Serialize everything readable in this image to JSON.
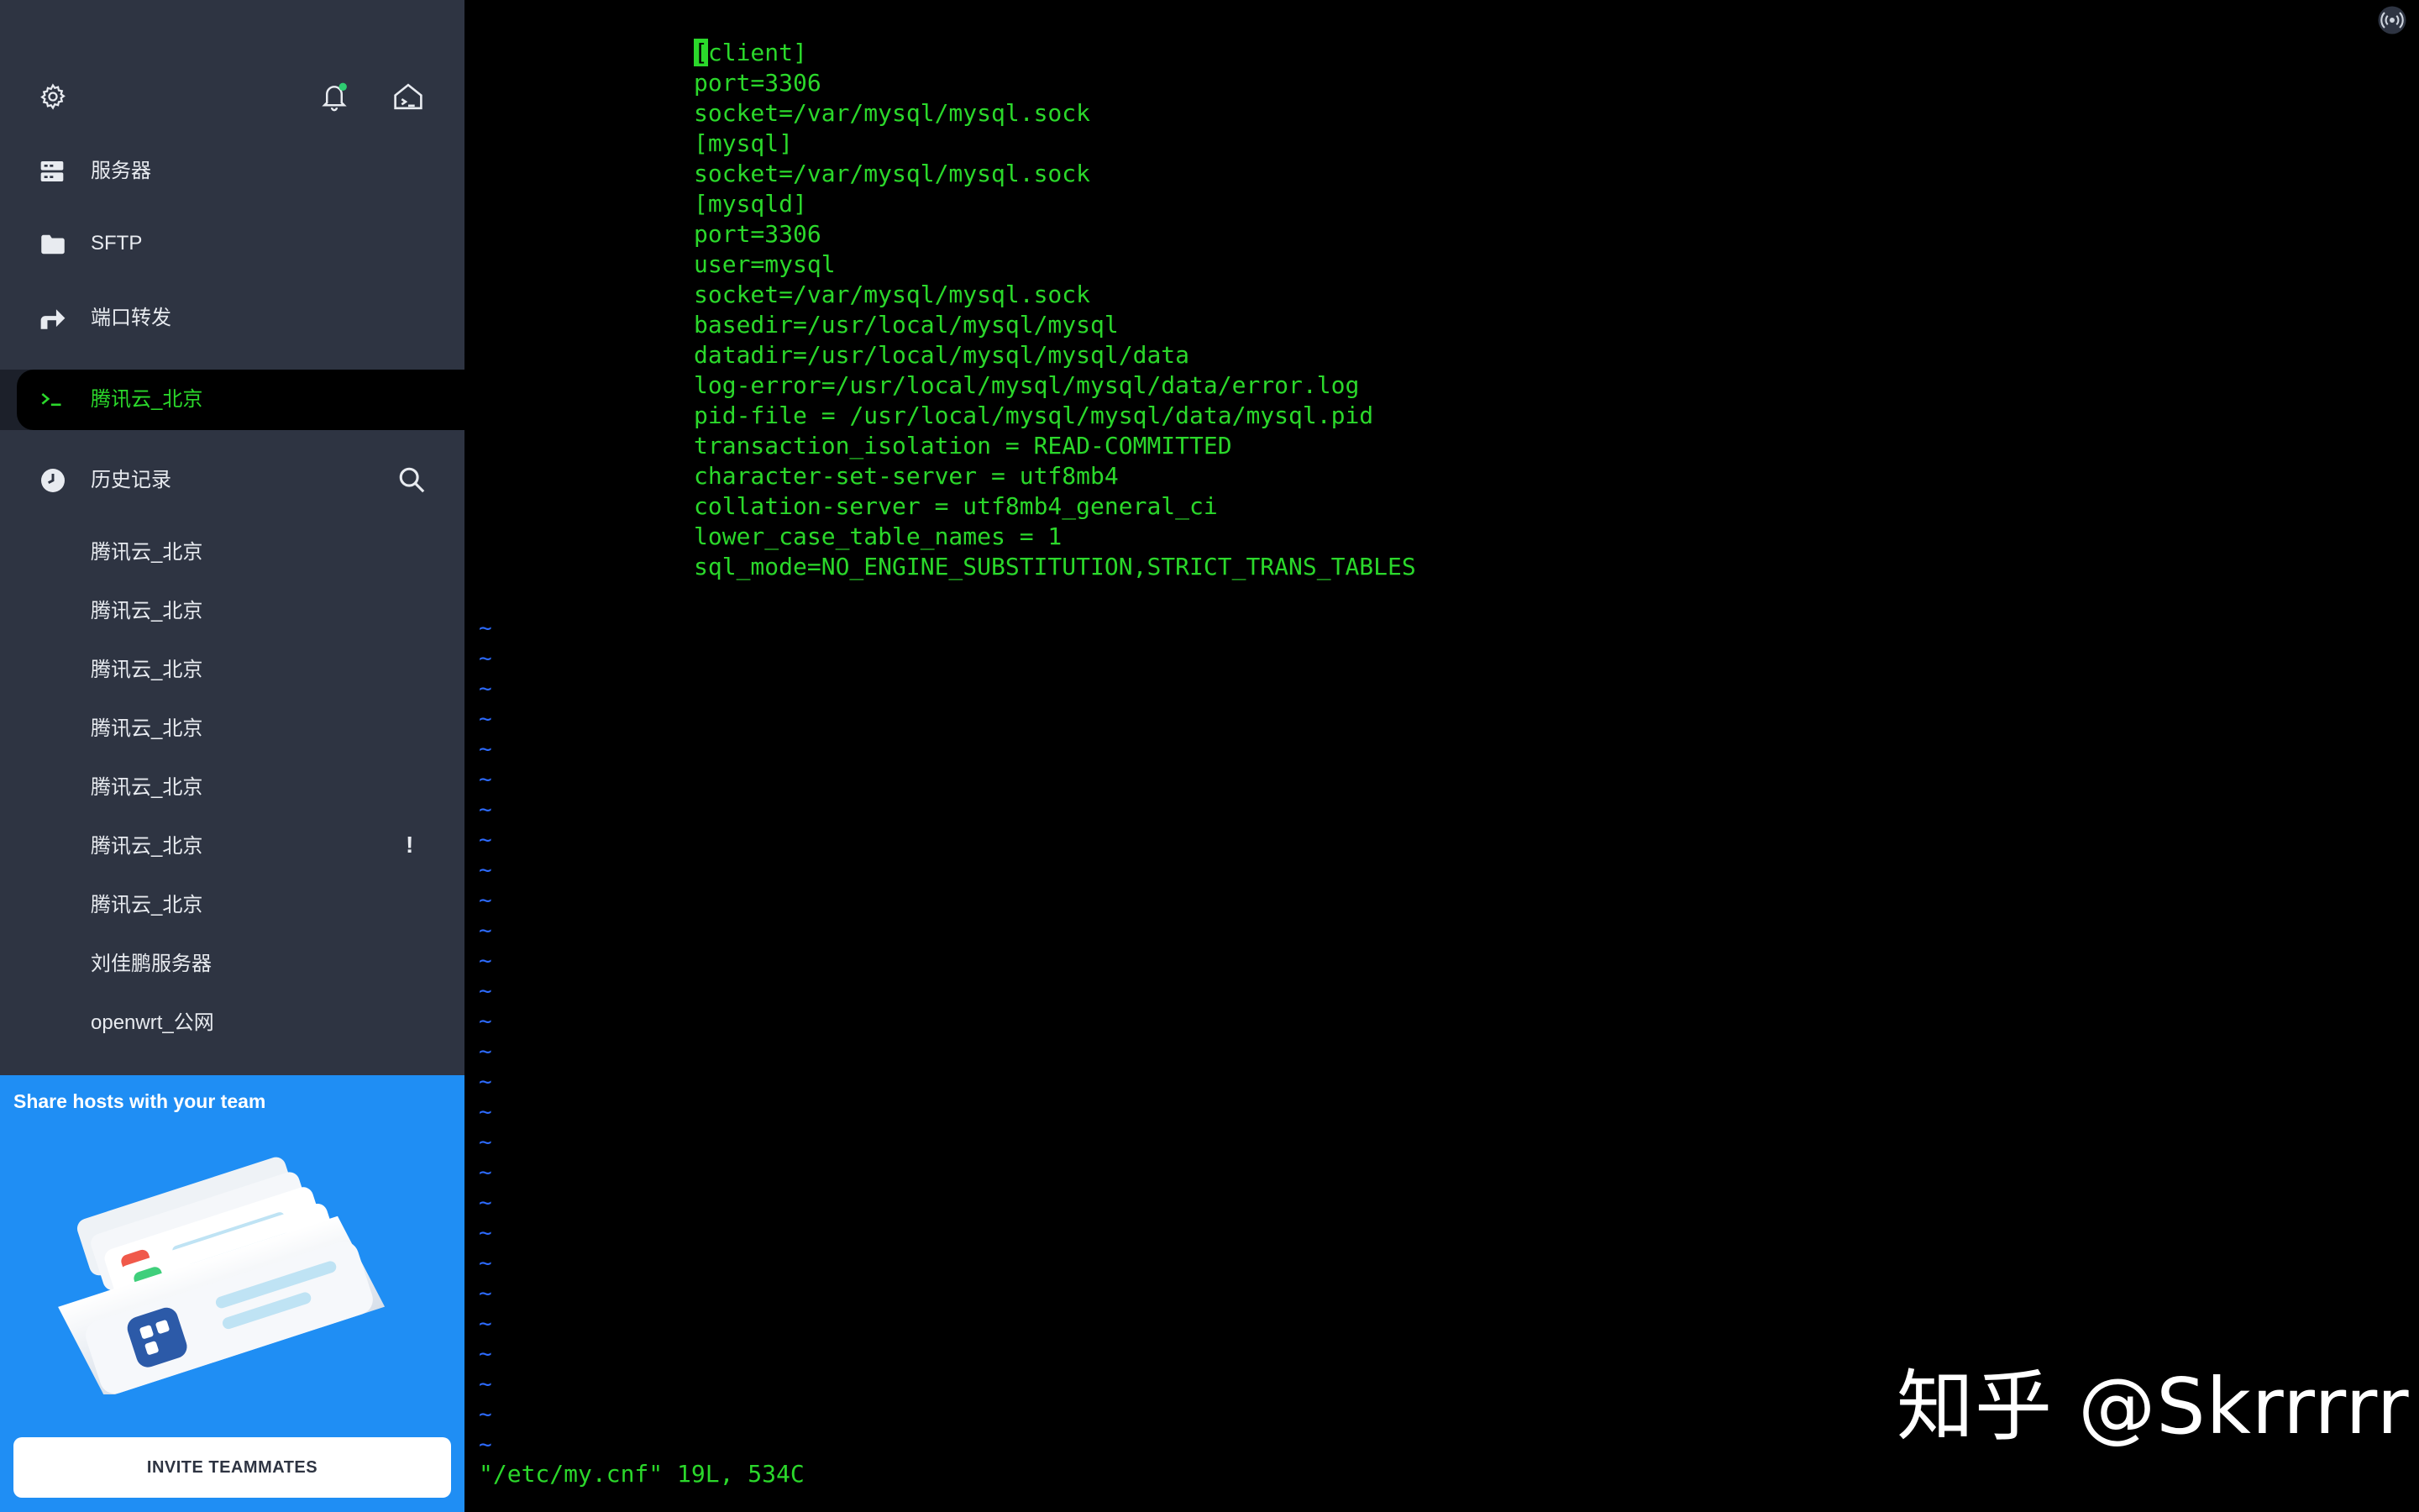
{
  "sidebar": {
    "nav": [
      {
        "label": "服务器",
        "icon": "server-icon"
      },
      {
        "label": "SFTP",
        "icon": "folder-icon"
      },
      {
        "label": "端口转发",
        "icon": "port-forward-icon"
      }
    ],
    "active_session": {
      "label": "腾讯云_北京",
      "icon": "terminal-prompt-icon"
    },
    "history": {
      "title": "历史记录",
      "items": [
        "腾讯云_北京",
        "腾讯云_北京",
        "腾讯云_北京",
        "腾讯云_北京",
        "腾讯云_北京",
        "腾讯云_北京",
        "腾讯云_北京",
        "刘佳鹏服务器",
        "openwrt_公网"
      ],
      "warning_mark": "!"
    }
  },
  "promo": {
    "title": "Share hosts with your team",
    "button_label": "INVITE TEAMMATES"
  },
  "terminal": {
    "cursor_char": "[",
    "first_line_rest": "client]",
    "lines": [
      "port=3306",
      "socket=/var/mysql/mysql.sock",
      "[mysql]",
      "socket=/var/mysql/mysql.sock",
      "[mysqld]",
      "port=3306",
      "user=mysql",
      "socket=/var/mysql/mysql.sock",
      "basedir=/usr/local/mysql/mysql",
      "datadir=/usr/local/mysql/mysql/data",
      "log-error=/usr/local/mysql/mysql/data/error.log",
      "pid-file = /usr/local/mysql/mysql/data/mysql.pid",
      "transaction_isolation = READ-COMMITTED",
      "character-set-server = utf8mb4",
      "collation-server = utf8mb4_general_ci",
      "lower_case_table_names = 1",
      "sql_mode=NO_ENGINE_SUBSTITUTION,STRICT_TRANS_TABLES"
    ],
    "tilde_char": "~",
    "status": "\"/etc/my.cnf\" 19L, 534C"
  },
  "watermark": "知乎 @Skrrrrr",
  "colors": {
    "sidebar_bg": "#2e3442",
    "terminal_text": "#2bd82b",
    "tilde": "#2d6bff",
    "promo_bg": "#1f8ef4",
    "notification_dot": "#2ecc71",
    "active_label": "#2bd82b"
  }
}
